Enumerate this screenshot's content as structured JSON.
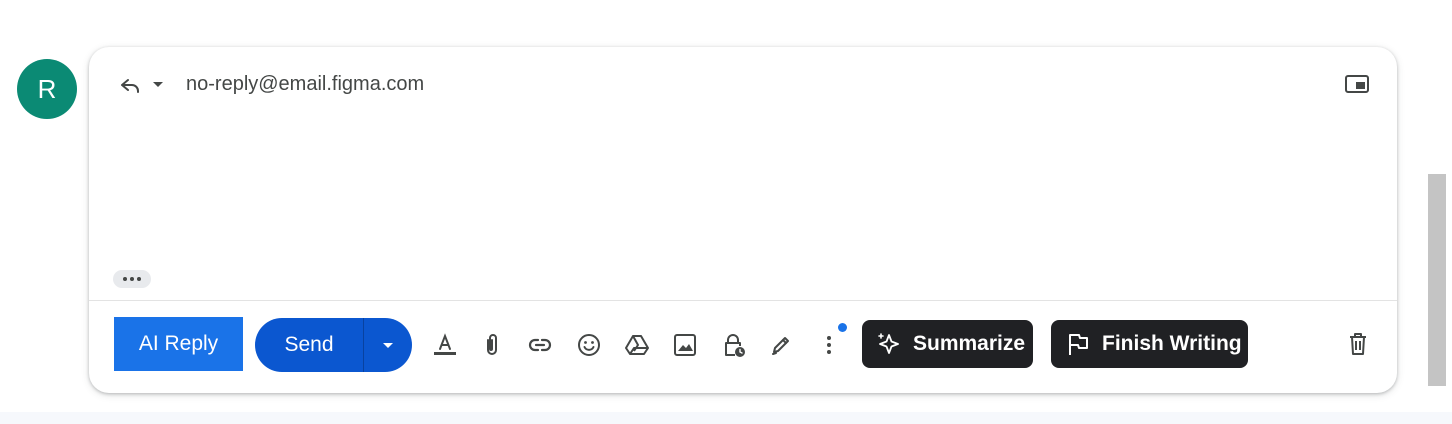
{
  "avatar": {
    "initial": "R",
    "color": "#0b8a74"
  },
  "compose": {
    "reply_icon": "reply-icon",
    "reply_menu_icon": "caret-down-icon",
    "recipient": "no-reply@email.figma.com",
    "popout_icon": "popout-icon",
    "body": "",
    "trimmed_content_icon": "ellipsis-icon"
  },
  "toolbar": {
    "ai_reply_label": "AI Reply",
    "send_label": "Send",
    "send_options_icon": "caret-down-icon",
    "tools": [
      "text-format-icon",
      "attach-icon",
      "link-icon",
      "emoji-icon",
      "drive-icon",
      "photo-icon",
      "confidential-mode-icon",
      "signature-icon",
      "more-options-icon"
    ],
    "summarize_label": "Summarize",
    "finish_writing_label": "Finish Writing",
    "discard_icon": "trash-icon"
  },
  "colors": {
    "ai_reply": "#1a73e8",
    "send": "#0b57d0",
    "pill": "#202124",
    "notification_dot": "#1a73e8"
  }
}
